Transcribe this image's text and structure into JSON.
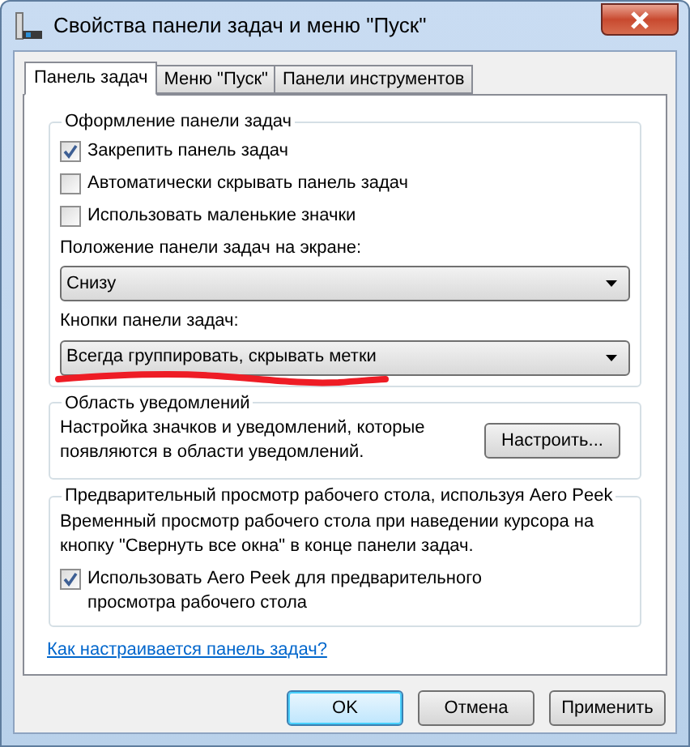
{
  "window": {
    "title": "Свойства панели задач и меню \"Пуск\""
  },
  "tabs": [
    {
      "label": "Панель задач",
      "selected": true
    },
    {
      "label": "Меню \"Пуск\"",
      "selected": false
    },
    {
      "label": "Панели инструментов",
      "selected": false
    }
  ],
  "taskbar_group": {
    "title": "Оформление панели задач",
    "checkboxes": [
      {
        "label": "Закрепить панель задач",
        "checked": true
      },
      {
        "label": "Автоматически скрывать панель задач",
        "checked": false
      },
      {
        "label": "Использовать маленькие значки",
        "checked": false
      }
    ],
    "position": {
      "label": "Положение панели задач на экране:",
      "value": "Снизу"
    },
    "taskbar_buttons": {
      "label": "Кнопки панели задач:",
      "value": "Всегда группировать, скрывать метки",
      "marked": true
    }
  },
  "notification_area": {
    "title": "Область уведомлений",
    "description": "Настройка значков и уведомлений, которые появляются в области уведомлений.",
    "button": "Настроить..."
  },
  "aero_peek": {
    "title": "Предварительный просмотр рабочего стола, используя Aero Peek",
    "description": "Временный просмотр рабочего стола при наведении курсора на кнопку \"Свернуть все окна\" в конце панели задач.",
    "checkbox": {
      "label": "Использовать Aero Peek для предварительного просмотра рабочего стола",
      "checked": true
    }
  },
  "help_link": "Как настраивается панель задач?",
  "buttons": [
    {
      "label": "OK",
      "default": true
    },
    {
      "label": "Отмена",
      "default": false
    },
    {
      "label": "Применить",
      "default": false
    }
  ]
}
